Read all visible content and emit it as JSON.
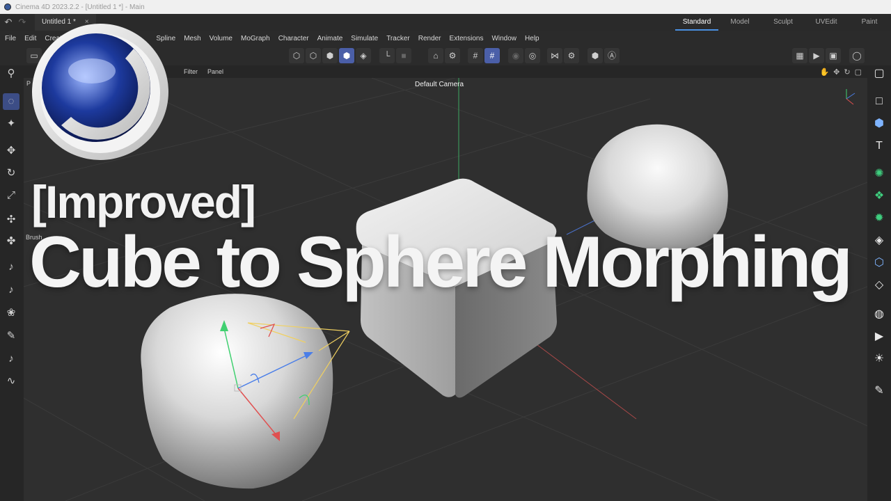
{
  "window": {
    "title": "Cinema 4D 2023.2.2 - [Untitled 1 *] - Main"
  },
  "tabs": {
    "document": "Untitled 1 *",
    "close": "×",
    "layouts": [
      "Standard",
      "Model",
      "Sculpt",
      "UVEdit",
      "Paint"
    ],
    "active_layout": "Standard"
  },
  "menu": [
    "File",
    "Edit",
    "Create",
    "Spline",
    "Mesh",
    "Volume",
    "MoGraph",
    "Character",
    "Animate",
    "Simulate",
    "Tracker",
    "Render",
    "Extensions",
    "Window",
    "Help"
  ],
  "viewport": {
    "menu": [
      "Filter",
      "Panel"
    ],
    "persp_label": "P",
    "camera_label": "Default Camera",
    "brush_label": "Brush"
  },
  "overlay": {
    "line1": "[Improved]",
    "line2": "Cube to Sphere Morphing"
  },
  "colors": {
    "accent": "#4a90e2",
    "axis_x": "#e05050",
    "axis_y": "#40d070",
    "axis_z": "#4a7ee8",
    "camera_frustum": "#f0d060"
  }
}
